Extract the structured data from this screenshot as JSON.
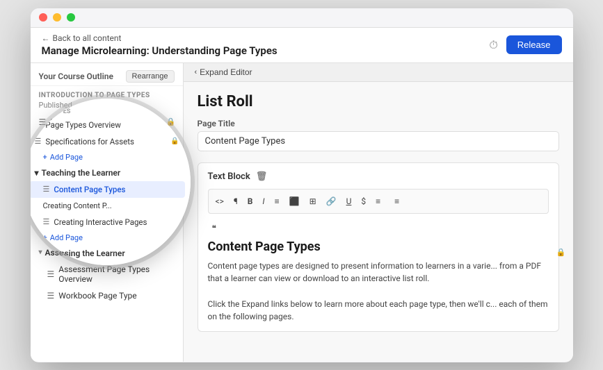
{
  "window": {
    "title": "Manage Microlearning: Understanding Page Types"
  },
  "header": {
    "back_text": "Back to all content",
    "title": "Manage Microlearning: Understanding Page Types",
    "release_label": "Release"
  },
  "sidebar": {
    "header_label": "Your Course Outline",
    "rearrange_label": "Rearrange",
    "section_label": "INTRODUCTION TO PAGE TYPES",
    "published_label": "Published",
    "items": [
      {
        "label": "Page Types Overview",
        "icon": "☰",
        "indented": true
      },
      {
        "label": "Specifications for Assets",
        "icon": "☰",
        "indented": true
      },
      {
        "label": "Add Page",
        "type": "add",
        "indented": true
      }
    ],
    "group1": {
      "label": "Teaching the Learner",
      "items": [
        {
          "label": "Content Page Types",
          "icon": "☰",
          "active": true,
          "indented": true
        },
        {
          "label": "Creating Content P...",
          "icon": "",
          "indented": true
        },
        {
          "label": "Creating Interactive Pages",
          "icon": "☰",
          "indented": true
        },
        {
          "label": "Add Page",
          "type": "add",
          "indented": true
        }
      ]
    },
    "group2": {
      "label": "Assessing the Learner",
      "items": [
        {
          "label": "Assessment Page Types Overview",
          "icon": "☰",
          "indented": true
        },
        {
          "label": "Workbook Page Type",
          "icon": "☰",
          "indented": true
        }
      ]
    }
  },
  "editor": {
    "expand_label": "Expand Editor",
    "page_section_title": "List Roll",
    "page_title_label": "Page Title",
    "page_title_value": "Content Page Types",
    "text_block_label": "Text Block",
    "toolbar_buttons": [
      "<>",
      "¶",
      "B",
      "I",
      "≡",
      "🖼",
      "⊞",
      "🔗",
      "U",
      "$",
      "≡",
      "≡"
    ],
    "content_heading": "Content Page Types",
    "content_body_1": "Content page types are designed to present information to learners in a varie... from a PDF that a learner can view or download to an interactive list roll.",
    "content_body_2": "Click the Expand links below to learn more about each page type, then we'll c... each of them on the following pages."
  },
  "magnifier": {
    "section_label": "Page Types",
    "items": [
      {
        "label": "Page Types Overview",
        "icon": "☰",
        "active": false
      },
      {
        "label": "Specifications for Assets",
        "icon": "☰",
        "active": false
      },
      {
        "label": "Add Page",
        "type": "add"
      }
    ],
    "group1_label": "Teaching the Learner",
    "group1_items": [
      {
        "label": "Content Page Types",
        "icon": "☰",
        "active": true
      }
    ],
    "group2_label": "Creating Content P...",
    "group2_items": [
      {
        "label": "Creating Interactive Pages",
        "icon": "☰",
        "active": false
      },
      {
        "label": "Add Page",
        "type": "add"
      }
    ],
    "group3_label": "Assessing the Learner",
    "group3_items": [
      {
        "label": "Assessment Page Types Overview",
        "icon": "☰",
        "active": false
      },
      {
        "label": "Workbook Page Type",
        "icon": "☰",
        "active": false
      }
    ]
  }
}
